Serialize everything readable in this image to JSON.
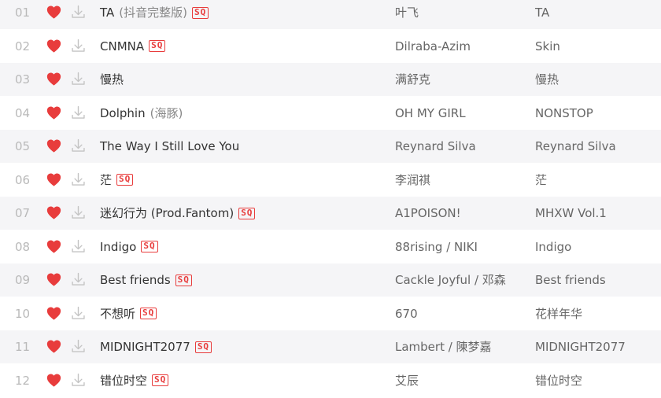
{
  "colors": {
    "heart": "#e83c3c",
    "sq_badge": "#e83c3c",
    "row_stripe": "#f5f5f7",
    "index_text": "#b9b9b9",
    "title_text": "#333333",
    "meta_text": "#666666"
  },
  "icons": {
    "like": "heart-icon",
    "download": "download-icon",
    "quality": "sq-badge"
  },
  "songs": [
    {
      "index": "01",
      "title": "TA",
      "subtitle": "(抖音完整版)",
      "badge": "SQ",
      "artist": "叶飞",
      "album": "TA"
    },
    {
      "index": "02",
      "title": "CNMNA",
      "subtitle": "",
      "badge": "SQ",
      "artist": "Dilraba-Azim",
      "album": "Skin"
    },
    {
      "index": "03",
      "title": "慢热",
      "subtitle": "",
      "badge": "",
      "artist": "满舒克",
      "album": "慢热"
    },
    {
      "index": "04",
      "title": "Dolphin",
      "subtitle": "(海豚)",
      "badge": "",
      "artist": "OH MY GIRL",
      "album": "NONSTOP"
    },
    {
      "index": "05",
      "title": "The Way I Still Love You",
      "subtitle": "",
      "badge": "",
      "artist": "Reynard Silva",
      "album": "Reynard Silva"
    },
    {
      "index": "06",
      "title": "茫",
      "subtitle": "",
      "badge": "SQ",
      "artist": "李润祺",
      "album": "茫"
    },
    {
      "index": "07",
      "title": "迷幻行为 (Prod.Fantom)",
      "subtitle": "",
      "badge": "SQ",
      "artist": "A1POISON!",
      "album": "MHXW Vol.1"
    },
    {
      "index": "08",
      "title": "Indigo",
      "subtitle": "",
      "badge": "SQ",
      "artist": "88rising / NIKI",
      "album": "Indigo"
    },
    {
      "index": "09",
      "title": "Best friends",
      "subtitle": "",
      "badge": "SQ",
      "artist": "Cackle Joyful / 邓森",
      "album": "Best friends"
    },
    {
      "index": "10",
      "title": "不想听",
      "subtitle": "",
      "badge": "SQ",
      "artist": "670",
      "album": "花样年华"
    },
    {
      "index": "11",
      "title": "MIDNIGHT2077",
      "subtitle": "",
      "badge": "SQ",
      "artist": "Lambert / 陳梦嘉",
      "album": "MIDNIGHT2077"
    },
    {
      "index": "12",
      "title": "错位时空",
      "subtitle": "",
      "badge": "SQ",
      "artist": "艾辰",
      "album": "错位时空"
    }
  ]
}
